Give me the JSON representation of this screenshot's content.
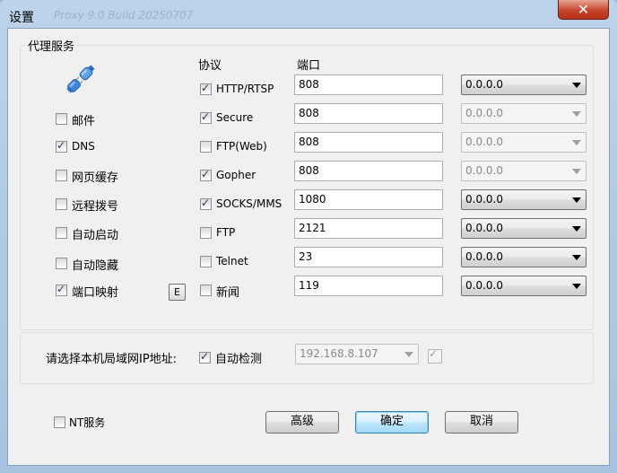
{
  "window": {
    "title": "设置",
    "ghost_title": "Proxy 9.0 Build 20250707"
  },
  "proxy_group": {
    "title": "代理服务",
    "col_protocol": "协议",
    "col_port": "端口",
    "services": [
      {
        "label": "邮件",
        "checked": false
      },
      {
        "label": "DNS",
        "checked": true
      },
      {
        "label": "网页缓存",
        "checked": false
      },
      {
        "label": "远程拨号",
        "checked": false
      },
      {
        "label": "自动启动",
        "checked": false
      },
      {
        "label": "自动隐藏",
        "checked": false
      },
      {
        "label": "端口映射",
        "checked": true
      }
    ],
    "mapping_edit_label": "E",
    "protocols": [
      {
        "label": "HTTP/RTSP",
        "checked": true,
        "port": "808",
        "ip": "0.0.0.0",
        "ip_enabled": true
      },
      {
        "label": "Secure",
        "checked": true,
        "port": "808",
        "ip": "0.0.0.0",
        "ip_enabled": false
      },
      {
        "label": "FTP(Web)",
        "checked": false,
        "port": "808",
        "ip": "0.0.0.0",
        "ip_enabled": false
      },
      {
        "label": "Gopher",
        "checked": true,
        "port": "808",
        "ip": "0.0.0.0",
        "ip_enabled": false
      },
      {
        "label": "SOCKS/MMS",
        "checked": true,
        "port": "1080",
        "ip": "0.0.0.0",
        "ip_enabled": true
      },
      {
        "label": "FTP",
        "checked": false,
        "port": "2121",
        "ip": "0.0.0.0",
        "ip_enabled": true
      },
      {
        "label": "Telnet",
        "checked": false,
        "port": "23",
        "ip": "0.0.0.0",
        "ip_enabled": true
      },
      {
        "label": "新闻",
        "checked": false,
        "port": "119",
        "ip": "0.0.0.0",
        "ip_enabled": true
      }
    ]
  },
  "lan": {
    "label": "请选择本机局域网IP地址:",
    "auto_detect_label": "自动检测",
    "auto_detect_checked": true,
    "ip_value": "192.168.8.107",
    "extra_checked": true
  },
  "footer": {
    "nt_service_label": "NT服务",
    "nt_service_checked": false,
    "advanced_label": "高级",
    "ok_label": "确定",
    "cancel_label": "取消"
  }
}
